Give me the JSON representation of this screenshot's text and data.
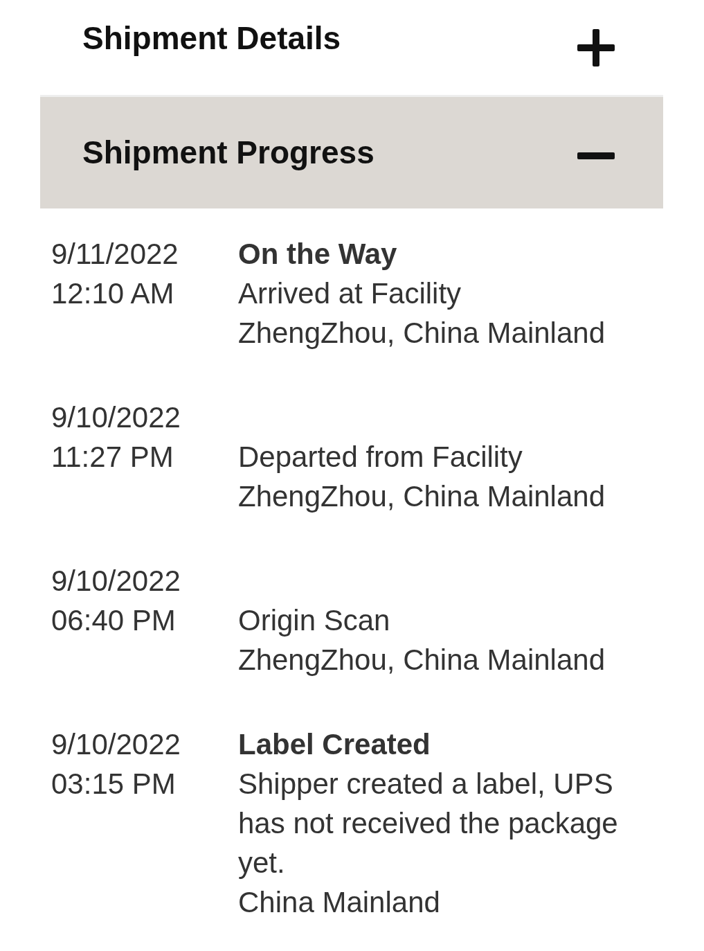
{
  "sections": [
    {
      "title": "Shipment Details",
      "expanded": false
    },
    {
      "title": "Shipment Progress",
      "expanded": true,
      "events": [
        {
          "date": "9/11/2022",
          "time": "12:10 AM",
          "status": "On the Way",
          "description": "Arrived at Facility",
          "location": "ZhengZhou, China Mainland"
        },
        {
          "date": "9/10/2022",
          "time": "11:27 PM",
          "description": "Departed from Facility",
          "location": "ZhengZhou, China Mainland"
        },
        {
          "date": "9/10/2022",
          "time": "06:40 PM",
          "description": "Origin Scan",
          "location": "ZhengZhou, China Mainland"
        },
        {
          "date": "9/10/2022",
          "time": "03:15 PM",
          "status": "Label Created",
          "description": "Shipper created a label, UPS has not received the package yet.",
          "location": "China Mainland"
        }
      ]
    }
  ]
}
